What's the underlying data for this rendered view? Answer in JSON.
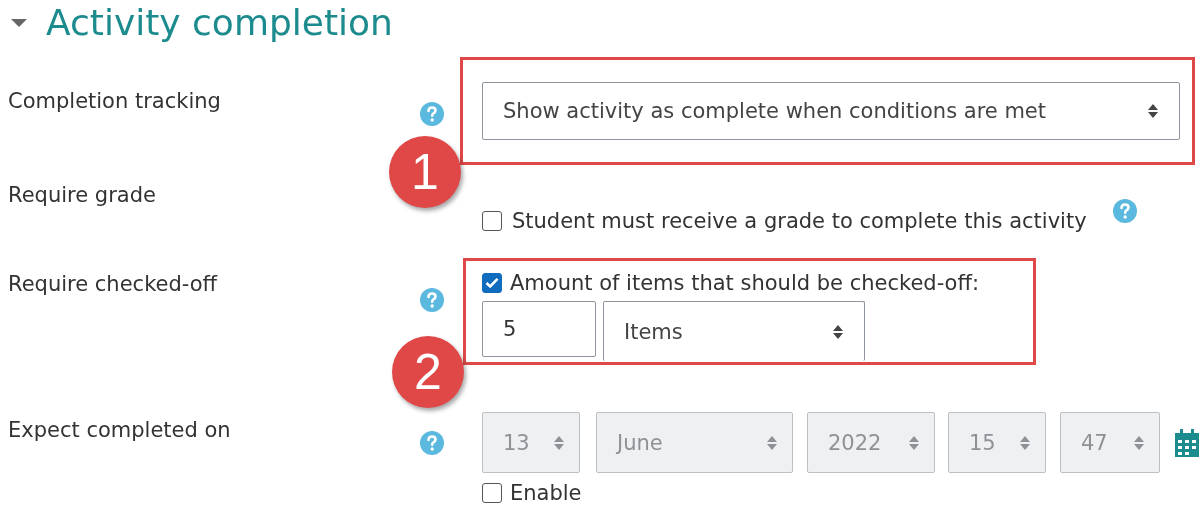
{
  "section": {
    "title": "Activity completion",
    "expanded": true
  },
  "fields": [
    {
      "kind": "select",
      "label": "Completion tracking",
      "value": "Show activity as complete when conditions are met",
      "annotation": "1"
    },
    {
      "kind": "checkbox",
      "label": "Require grade",
      "checkbox_label": "Student must receive a grade to complete this activity",
      "checked": false
    },
    {
      "kind": "checkoff",
      "label": "Require checked-off",
      "checkbox_label": "Amount of items that should be checked-off:",
      "checked": true,
      "amount": "5",
      "unit": "Items",
      "annotation": "2"
    },
    {
      "kind": "date",
      "label": "Expect completed on",
      "parts": [
        "13",
        "June",
        "2022",
        "15",
        "47"
      ],
      "enable_label": "Enable",
      "enabled": false
    }
  ]
}
